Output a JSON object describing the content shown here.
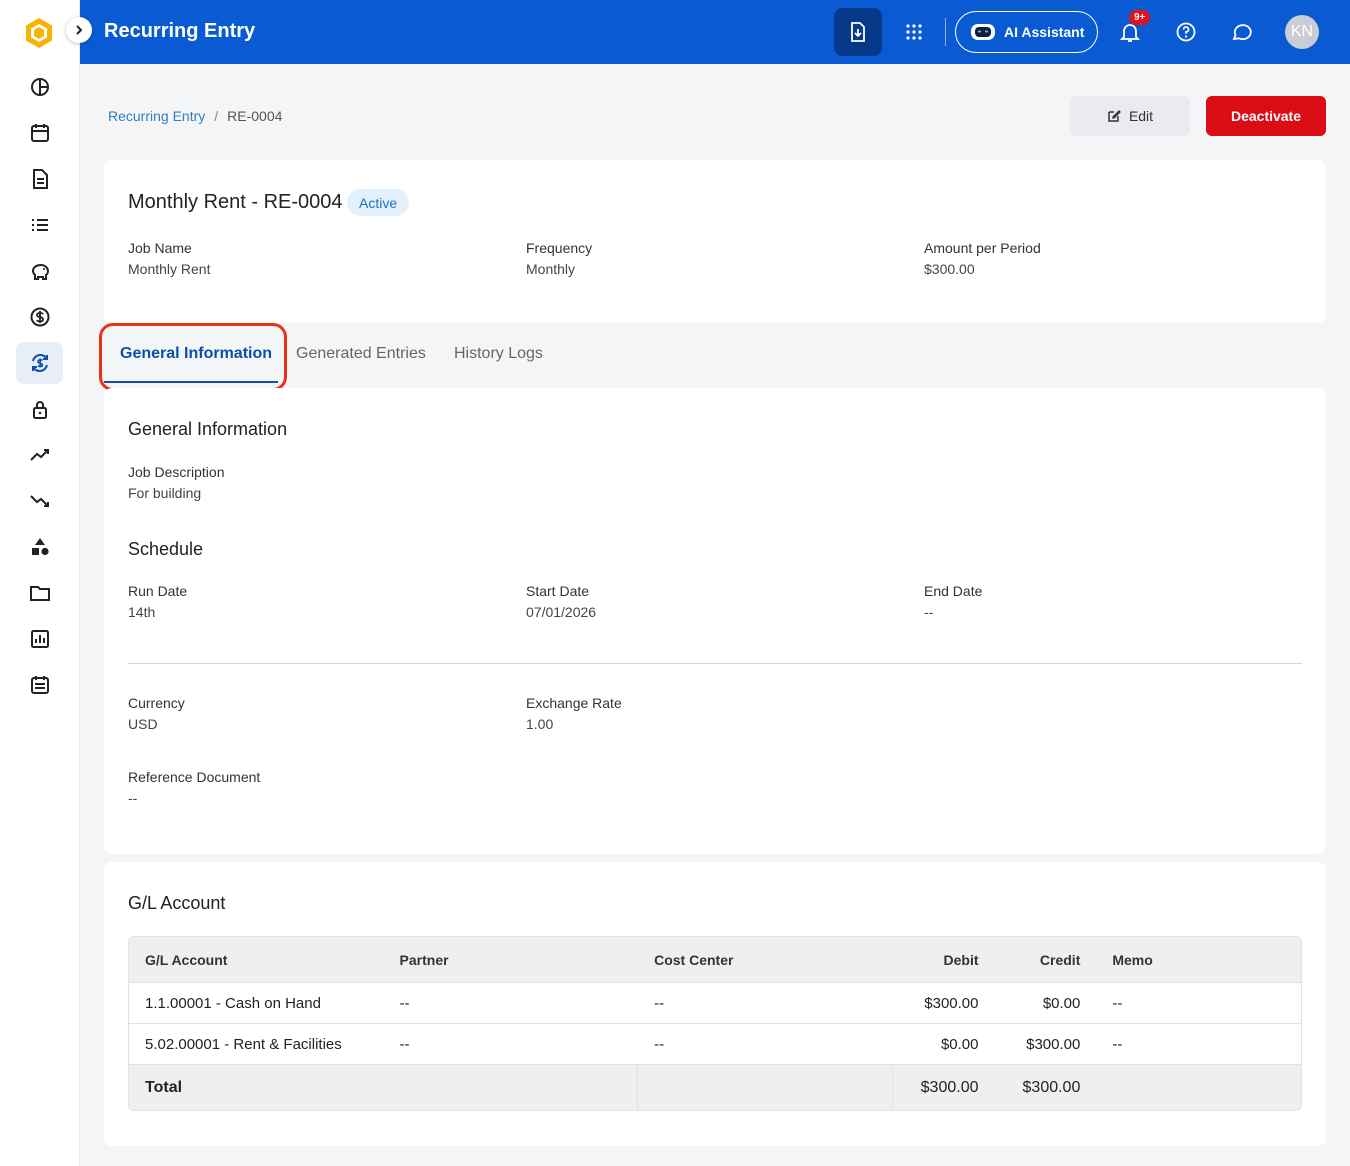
{
  "app": {
    "title": "Recurring Entry"
  },
  "topbar": {
    "ai_label": "AI Assistant",
    "notif_count": "9+",
    "avatar_initials": "KN"
  },
  "breadcrumb": {
    "parent": "Recurring Entry",
    "separator": "/",
    "current": "RE-0004"
  },
  "actions": {
    "edit": "Edit",
    "deactivate": "Deactivate"
  },
  "summary": {
    "title": "Monthly Rent - RE-0004",
    "status": "Active",
    "fields": [
      {
        "label": "Job Name",
        "value": "Monthly Rent"
      },
      {
        "label": "Frequency",
        "value": "Monthly"
      },
      {
        "label": "Amount per Period",
        "value": "$300.00"
      }
    ]
  },
  "tabs": [
    {
      "label": "General Information",
      "active": true
    },
    {
      "label": "Generated Entries",
      "active": false
    },
    {
      "label": "History Logs",
      "active": false
    }
  ],
  "general": {
    "heading": "General Information",
    "job_description": {
      "label": "Job Description",
      "value": "For building"
    },
    "schedule_heading": "Schedule",
    "run_date": {
      "label": "Run Date",
      "value": "14th"
    },
    "start_date": {
      "label": "Start Date",
      "value": "07/01/2026"
    },
    "end_date": {
      "label": "End Date",
      "value": "--"
    },
    "currency": {
      "label": "Currency",
      "value": "USD"
    },
    "exchange_rate": {
      "label": "Exchange Rate",
      "value": "1.00"
    },
    "reference_document": {
      "label": "Reference Document",
      "value": "--"
    }
  },
  "gl": {
    "heading": "G/L Account",
    "columns": {
      "account": "G/L Account",
      "partner": "Partner",
      "cost_center": "Cost Center",
      "debit": "Debit",
      "credit": "Credit",
      "memo": "Memo"
    },
    "rows": [
      {
        "account": "1.1.00001 - Cash on Hand",
        "partner": "--",
        "cost_center": "--",
        "debit": "$300.00",
        "credit": "$0.00",
        "memo": "--"
      },
      {
        "account": "5.02.00001 - Rent & Facilities",
        "partner": "--",
        "cost_center": "--",
        "debit": "$0.00",
        "credit": "$300.00",
        "memo": "--"
      }
    ],
    "total": {
      "label": "Total",
      "debit": "$300.00",
      "credit": "$300.00"
    }
  },
  "colors": {
    "brand": "#0a5bd3",
    "danger": "#dc0c15",
    "active_tab": "#0b4fa8",
    "highlight": "#e8331b"
  }
}
